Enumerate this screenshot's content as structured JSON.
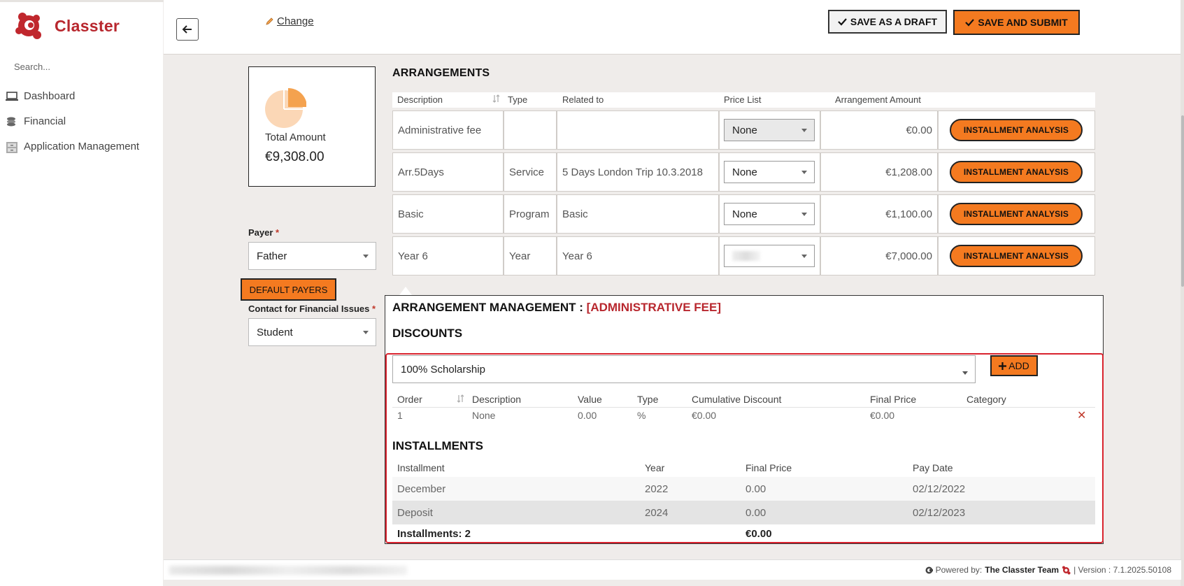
{
  "app": {
    "name": "Classter",
    "search_placeholder": "Search..."
  },
  "sidebar": {
    "items": [
      {
        "label": "Dashboard",
        "icon": "laptop-icon"
      },
      {
        "label": "Financial",
        "icon": "coins-icon"
      },
      {
        "label": "Application Management",
        "icon": "cabinet-icon"
      }
    ]
  },
  "header": {
    "change_label": "Change",
    "save_draft_label": "SAVE AS A DRAFT",
    "save_submit_label": "SAVE AND SUBMIT"
  },
  "summary": {
    "total_label": "Total Amount",
    "total_value": "€9,308.00"
  },
  "payer": {
    "label": "Payer",
    "value": "Father",
    "default_payers_label": "DEFAULT PAYERS",
    "contact_label": "Contact for Financial Issues",
    "contact_value": "Student"
  },
  "arrangements": {
    "title": "ARRANGEMENTS",
    "columns": [
      "Description",
      "Type",
      "Related to",
      "Price List",
      "Arrangement Amount"
    ],
    "rows": [
      {
        "description": "Administrative fee",
        "type": "",
        "related_to": "",
        "price_list": "None",
        "amount": "€0.00",
        "action": "INSTALLMENT ANALYSIS"
      },
      {
        "description": "Arr.5Days",
        "type": "Service",
        "related_to": "5 Days London Trip 10.3.2018",
        "price_list": "None",
        "amount": "€1,208.00",
        "action": "INSTALLMENT ANALYSIS"
      },
      {
        "description": "Basic",
        "type": "Program",
        "related_to": "Basic",
        "price_list": "None",
        "amount": "€1,100.00",
        "action": "INSTALLMENT ANALYSIS"
      },
      {
        "description": "Year 6",
        "type": "Year",
        "related_to": "Year 6",
        "price_list": "",
        "amount": "€7,000.00",
        "action": "INSTALLMENT ANALYSIS"
      }
    ]
  },
  "management": {
    "title_prefix": "ARRANGEMENT MANAGEMENT :",
    "title_highlight": "[ADMINISTRATIVE FEE]",
    "discounts_title": "DISCOUNTS",
    "discount_select": "100% Scholarship",
    "add_label": "ADD",
    "discount_columns": [
      "Order",
      "Description",
      "Value",
      "Type",
      "Cumulative Discount",
      "Final Price",
      "Category"
    ],
    "discount_rows": [
      {
        "order": "1",
        "description": "None",
        "value": "0.00",
        "type": "%",
        "cumulative": "€0.00",
        "final_price": "€0.00",
        "category": ""
      }
    ],
    "installments_title": "INSTALLMENTS",
    "installment_columns": [
      "Installment",
      "Year",
      "Final Price",
      "Pay Date"
    ],
    "installment_rows": [
      {
        "installment": "December",
        "year": "2022",
        "final_price": "0.00",
        "pay_date": "02/12/2022"
      },
      {
        "installment": "Deposit",
        "year": "2024",
        "final_price": "0.00",
        "pay_date": "02/12/2023"
      }
    ],
    "installments_count": "Installments: 2",
    "installments_total": "€0.00"
  },
  "footer": {
    "powered_by": "Powered by:",
    "team": "The Classter Team",
    "version": "| Version : 7.1.2025.50108"
  },
  "colors": {
    "accent": "#f47a20",
    "brand": "#b8272e",
    "highlight": "#d9232e"
  }
}
